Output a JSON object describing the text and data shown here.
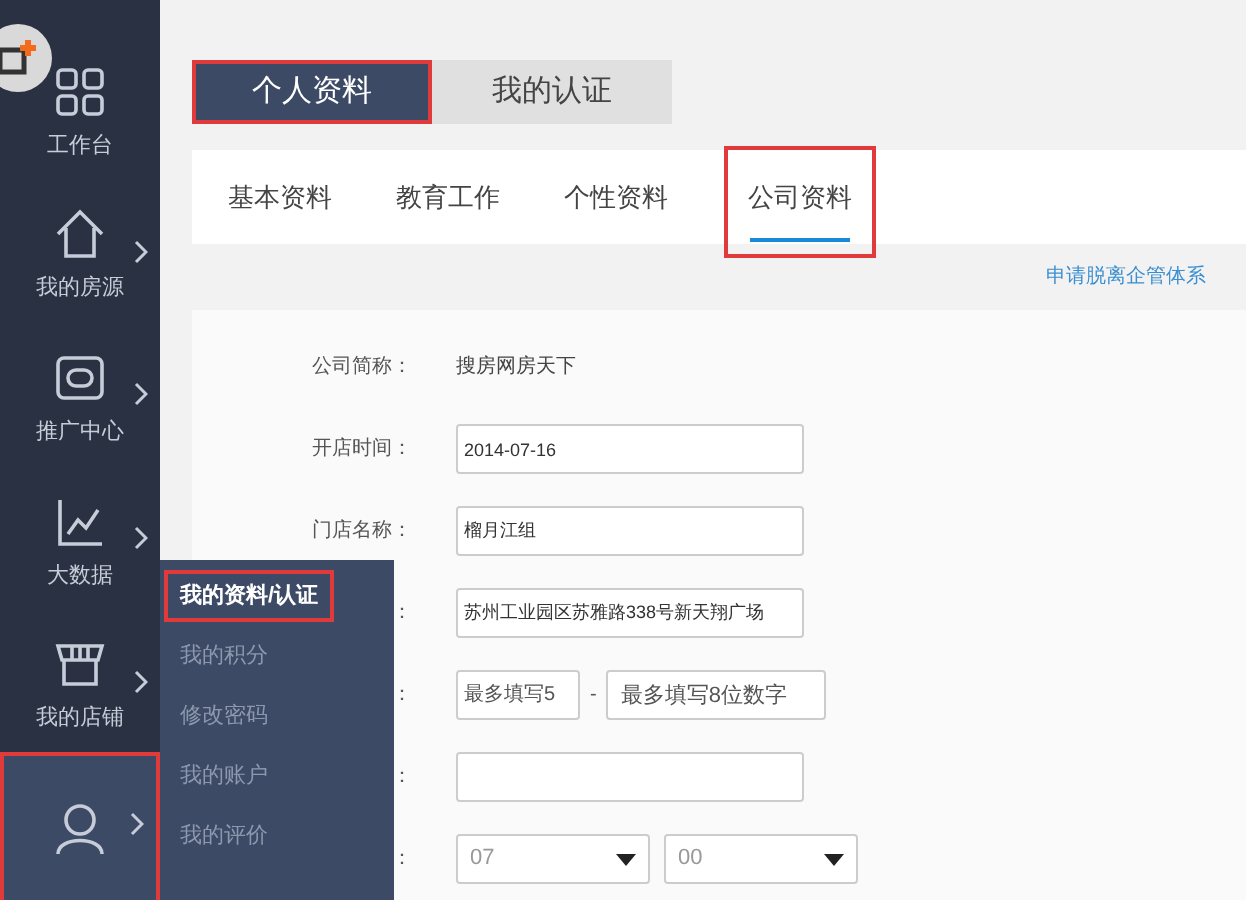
{
  "sidebar": {
    "items": [
      {
        "label": "工作台",
        "has_submenu": false,
        "highlighted": false
      },
      {
        "label": "我的房源",
        "has_submenu": true,
        "highlighted": false
      },
      {
        "label": "推广中心",
        "has_submenu": true,
        "highlighted": false
      },
      {
        "label": "大数据",
        "has_submenu": true,
        "highlighted": false
      },
      {
        "label": "我的店铺",
        "has_submenu": true,
        "highlighted": false
      },
      {
        "has_submenu": true,
        "highlighted": true
      }
    ]
  },
  "submenu": {
    "items": [
      {
        "label": "我的资料/认证",
        "selected": true,
        "highlighted": true
      },
      {
        "label": "我的积分",
        "selected": false,
        "highlighted": false
      },
      {
        "label": "修改密码",
        "selected": false,
        "highlighted": false
      },
      {
        "label": "我的账户",
        "selected": false,
        "highlighted": false
      },
      {
        "label": "我的评价",
        "selected": false,
        "highlighted": false
      }
    ]
  },
  "tabs": [
    {
      "label": "个人资料",
      "selected": true,
      "highlighted": true
    },
    {
      "label": "我的认证",
      "selected": false,
      "highlighted": false
    }
  ],
  "subtabs": [
    {
      "label": "基本资料",
      "selected": false,
      "highlighted": false
    },
    {
      "label": "教育工作",
      "selected": false,
      "highlighted": false
    },
    {
      "label": "个性资料",
      "selected": false,
      "highlighted": false
    },
    {
      "label": "公司资料",
      "selected": true,
      "highlighted": true
    }
  ],
  "link": "申请脱离企管体系",
  "form": [
    {
      "kind": "text",
      "label": "公司简称：",
      "value": "搜房网房天下"
    },
    {
      "kind": "input",
      "label": "开店时间：",
      "value": "2014-07-16"
    },
    {
      "kind": "input",
      "label": "门店名称：",
      "value": "榴月江组"
    },
    {
      "kind": "input",
      "label": "：",
      "value": "苏州工业园区苏雅路338号新天翔广场"
    },
    {
      "kind": "pair",
      "label": "：",
      "placeholders": [
        "最多填写5",
        "最多填写8位数字"
      ],
      "separator": "-"
    },
    {
      "kind": "input",
      "label": "："
    },
    {
      "kind": "selects",
      "label": "：",
      "values": [
        "07",
        "00"
      ]
    }
  ]
}
